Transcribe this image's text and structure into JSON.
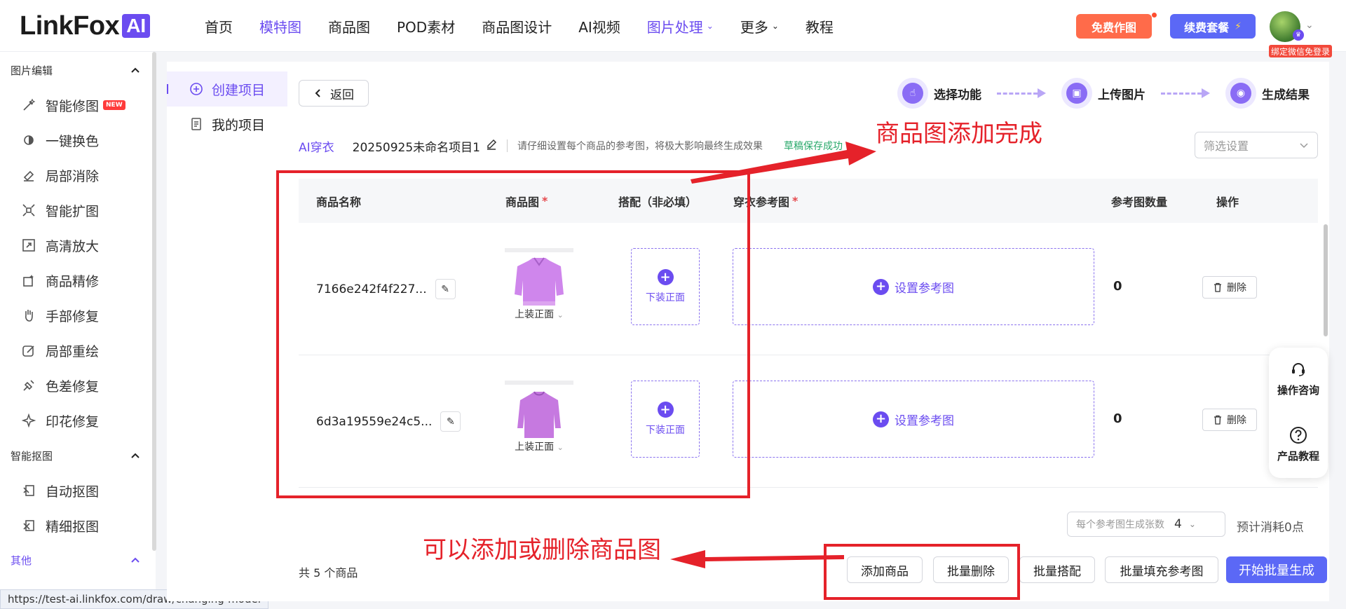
{
  "header": {
    "logo_text": "LinkFox",
    "logo_badge": "AI",
    "nav": [
      {
        "label": "首页",
        "active": false,
        "dropdown": false
      },
      {
        "label": "模特图",
        "active": true,
        "dropdown": false
      },
      {
        "label": "商品图",
        "active": false,
        "dropdown": false
      },
      {
        "label": "POD素材",
        "active": false,
        "dropdown": false
      },
      {
        "label": "商品图设计",
        "active": false,
        "dropdown": false
      },
      {
        "label": "AI视频",
        "active": false,
        "dropdown": false
      },
      {
        "label": "图片处理",
        "active": true,
        "dropdown": true
      },
      {
        "label": "更多",
        "active": false,
        "dropdown": true
      },
      {
        "label": "教程",
        "active": false,
        "dropdown": false
      }
    ],
    "free_btn": "免费作图",
    "renew_btn": "续费套餐",
    "wechat_tag": "绑定微信免登录"
  },
  "sidebar": {
    "groups": [
      {
        "label": "图片编辑"
      },
      {
        "label": "智能抠图"
      },
      {
        "label": "其他"
      }
    ],
    "edit_items": [
      {
        "label": "智能修图",
        "icon": "magic-wand-icon",
        "badge": "NEW"
      },
      {
        "label": "一键换色",
        "icon": "color-swap-icon",
        "badge": ""
      },
      {
        "label": "局部消除",
        "icon": "eraser-icon",
        "badge": ""
      },
      {
        "label": "智能扩图",
        "icon": "expand-icon",
        "badge": ""
      },
      {
        "label": "高清放大",
        "icon": "upscale-icon",
        "badge": ""
      },
      {
        "label": "商品精修",
        "icon": "refine-icon",
        "badge": ""
      },
      {
        "label": "手部修复",
        "icon": "hand-icon",
        "badge": ""
      },
      {
        "label": "局部重绘",
        "icon": "repaint-icon",
        "badge": ""
      },
      {
        "label": "色差修复",
        "icon": "color-fix-icon",
        "badge": ""
      },
      {
        "label": "印花修复",
        "icon": "print-fix-icon",
        "badge": ""
      }
    ],
    "cutout_items": [
      {
        "label": "自动抠图",
        "icon": "auto-cutout-icon"
      },
      {
        "label": "精细抠图",
        "icon": "fine-cutout-icon"
      }
    ],
    "url_tip": "https://test-ai.linkfox.com/draw/changing-model"
  },
  "subnav": {
    "items": [
      {
        "label": "创建项目",
        "icon": "plus-circle-icon",
        "active": true
      },
      {
        "label": "我的项目",
        "icon": "document-icon",
        "active": false
      }
    ]
  },
  "main": {
    "back_btn": "返回",
    "steps": [
      {
        "label": "选择功能",
        "icon": "tap-icon"
      },
      {
        "label": "上传图片",
        "icon": "upload-image-icon"
      },
      {
        "label": "生成结果",
        "icon": "result-icon"
      }
    ],
    "crumb": {
      "tag": "AI穿衣",
      "project": "20250925未命名项目1",
      "tip": "请仔细设置每个商品的参考图，将极大影响最终生成效果",
      "saved": "草稿保存成功"
    },
    "filter_placeholder": "筛选设置",
    "table": {
      "columns": {
        "name": "商品名称",
        "image": "商品图",
        "match": "搭配（非必填）",
        "ref": "穿衣参考图",
        "count": "参考图数量",
        "action": "操作"
      },
      "rows": [
        {
          "name": "7166e242f4f227...",
          "image_label": "上装正面",
          "match_label": "下装正面",
          "ref_label": "设置参考图",
          "count": "0",
          "delete": "删除",
          "shirt_color": "#cf86ec"
        },
        {
          "name": "6d3a19559e24c5...",
          "image_label": "上装正面",
          "match_label": "下装正面",
          "ref_label": "设置参考图",
          "count": "0",
          "delete": "删除",
          "shirt_color": "#c679e0"
        }
      ]
    },
    "per_gen_placeholder": "每个参考图生成张数",
    "per_gen_value": "4",
    "estimate": "预计消耗0点",
    "total": "共 5 个商品",
    "buttons": {
      "add": "添加商品",
      "batch_delete": "批量删除",
      "batch_match": "批量搭配",
      "batch_fill": "批量填充参考图",
      "start": "开始批量生成"
    }
  },
  "float": {
    "consult": "操作咨询",
    "tutorial": "产品教程"
  },
  "annotations": {
    "top": "商品图添加完成",
    "bottom": "可以添加或删除商品图"
  },
  "colors": {
    "brand": "#6b4cf0",
    "primary_btn": "#5b68f6",
    "free_btn": "#ff6b4a",
    "annotation": "#e5222a",
    "saved": "#28a86a"
  }
}
